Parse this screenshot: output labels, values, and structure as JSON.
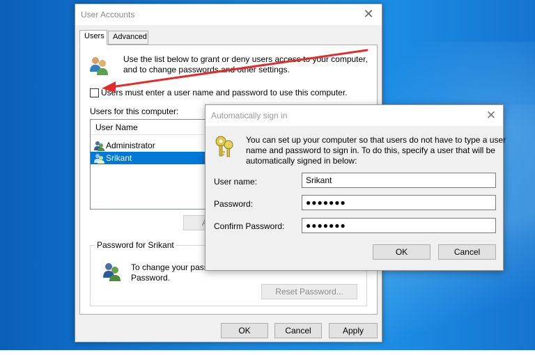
{
  "user_accounts": {
    "title": "User Accounts",
    "tabs": [
      {
        "label": "Users",
        "active": true
      },
      {
        "label": "Advanced",
        "active": false
      }
    ],
    "intro_line1": "Use the list below to grant or deny users access to your computer,",
    "intro_line2": "and to change passwords and other settings.",
    "checkbox_label": "Users must enter a user name and password to use this computer.",
    "checkbox_checked": false,
    "users_label": "Users for this computer:",
    "list_header": "User Name",
    "users": [
      {
        "name": "Administrator",
        "selected": false
      },
      {
        "name": "Srikant",
        "selected": true
      }
    ],
    "add_button_partial": "A",
    "password_group_label": "Password for Srikant",
    "password_text_line1": "To change your passv",
    "password_text_line2": "Password.",
    "reset_password_button": "Reset Password...",
    "ok_button": "OK",
    "cancel_button": "Cancel",
    "apply_button": "Apply"
  },
  "auto_signin": {
    "title": "Automatically sign in",
    "description_line1": "You can set up your computer so that users do not have to type a user",
    "description_line2": "name and password to sign in. To do this, specify a user that will be",
    "description_line3": "automatically signed in below:",
    "username_label": "User name:",
    "username_value": "Srikant",
    "password_label": "Password:",
    "password_value": "●●●●●●●",
    "confirm_label": "Confirm Password:",
    "confirm_value": "●●●●●●●",
    "ok_button": "OK",
    "cancel_button": "Cancel"
  },
  "colors": {
    "selection": "#0078d7",
    "annotation_arrow": "#e32b2b",
    "desktop": "#1b86df"
  },
  "icons": [
    "users-icon",
    "user-row-icon",
    "keys-icon",
    "close-icon"
  ]
}
